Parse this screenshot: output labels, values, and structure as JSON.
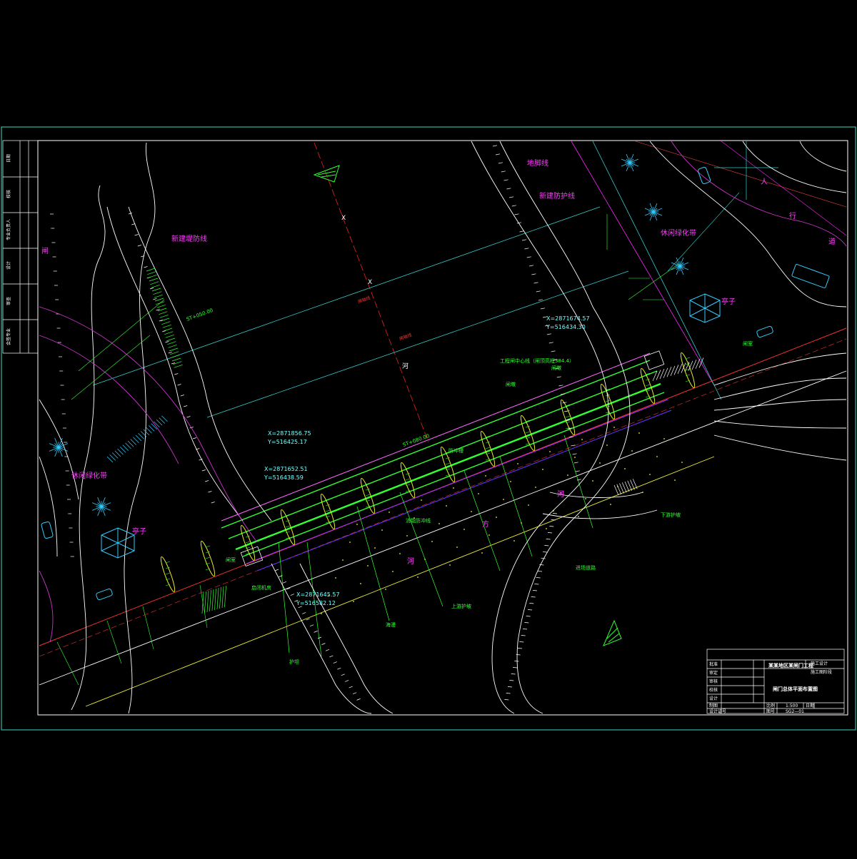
{
  "labels": {
    "corner_top_left": "闸",
    "left_green_belt": "休闲绿化带",
    "left_pavilion": "亭子",
    "right_pavilion": "亭子",
    "right_green_belt": "休闲绿化带",
    "top_slope": "新建堤防线",
    "ground_line": "地脚线",
    "bank_protection": "新建防护线",
    "road_chars": [
      "人",
      "行",
      "道"
    ],
    "river_chars": [
      "河",
      "方"
    ],
    "axis_marks": [
      "X",
      "X"
    ],
    "center_mark": "河",
    "cl_left": "闸轴线",
    "cl_right": "闸轴线"
  },
  "coordinates": {
    "c1": [
      "X=2871856.75",
      "Y=516425.17"
    ],
    "c2": [
      "X=2871652.51",
      "Y=516438.59"
    ],
    "c3": [
      "X=2871645.57",
      "Y=516582.12"
    ],
    "c4": [
      "X=2871674.57",
      "Y=516434.30"
    ]
  },
  "callouts": {
    "top_bank": "ST+050.00",
    "gate_axis": "ST+080.00",
    "gate_note": "工程闸中心线（闸顶高程384.4）",
    "pier1": "闸墩",
    "pier2": "闸墩",
    "valve": "启闭机房",
    "sluice_line": "消能防冲线",
    "bottom1": "护坦",
    "bottom2": "海漫",
    "bottom3": "上游护坡",
    "bottom4": "防冲槽",
    "right_road": "进场道路",
    "elevation_left": "闸室",
    "elevation_right": "闸室",
    "green_right": "下游护坡"
  },
  "sidebar": {
    "rows": [
      "专业负责人",
      "校核",
      "设计",
      "审查",
      "会签专业",
      "审核",
      "专业负责人",
      "日期"
    ]
  },
  "title_block": {
    "project": "某某地区某闸门工程",
    "stage_a": "施工设计",
    "stage_b": "施工图阶段",
    "drawing_title": "闸门总体平面布置图",
    "scale_label": "比例",
    "scale_value": "1:500",
    "date_label": "日期",
    "no_label": "图号",
    "no_value": "SG2—01",
    "roles": [
      "批准",
      "审定",
      "审核",
      "校核",
      "设计",
      "制图",
      "项目负责"
    ],
    "role_footer": "设计证号"
  }
}
